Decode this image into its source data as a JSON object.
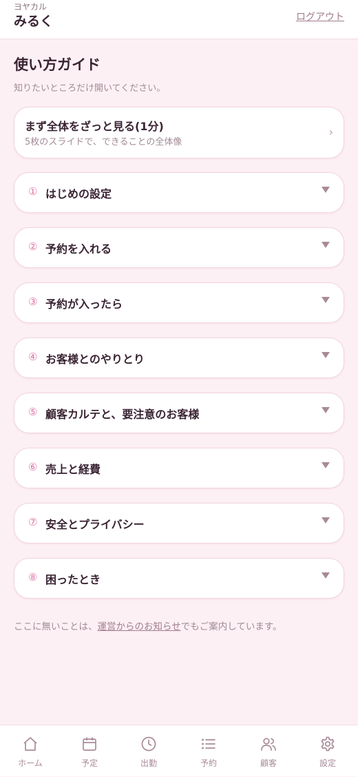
{
  "header": {
    "brand_sub": "ヨヤカル",
    "brand_main": "みるく",
    "logout_label": "ログアウト"
  },
  "main": {
    "title": "使い方ガイド",
    "subtitle": "知りたいところだけ開いてください。",
    "overview": {
      "title": "まず全体をざっと見る(1分)",
      "subtitle": "5枚のスライドで、できることの全体像",
      "chevron": "›"
    },
    "sections": [
      {
        "num": "①",
        "label": "はじめの設定"
      },
      {
        "num": "②",
        "label": "予約を入れる"
      },
      {
        "num": "③",
        "label": "予約が入ったら"
      },
      {
        "num": "④",
        "label": "お客様とのやりとり"
      },
      {
        "num": "⑤",
        "label": "顧客カルテと、要注意のお客様"
      },
      {
        "num": "⑥",
        "label": "売上と経費"
      },
      {
        "num": "⑦",
        "label": "安全とプライバシー"
      },
      {
        "num": "⑧",
        "label": "困ったとき"
      }
    ],
    "footnote": {
      "before": "ここに無いことは、",
      "link": "運営からのお知らせ",
      "after": "でもご案内しています。"
    }
  },
  "tabbar": {
    "items": [
      {
        "label": "ホーム",
        "icon": "home-icon"
      },
      {
        "label": "予定",
        "icon": "calendar-icon"
      },
      {
        "label": "出勤",
        "icon": "clock-icon"
      },
      {
        "label": "予約",
        "icon": "list-icon"
      },
      {
        "label": "顧客",
        "icon": "users-icon"
      },
      {
        "label": "設定",
        "icon": "gear-icon"
      }
    ]
  },
  "colors": {
    "background": "#fdf0f5",
    "accent": "#de77a7",
    "text": "#3a2433",
    "muted": "#a28a96"
  }
}
